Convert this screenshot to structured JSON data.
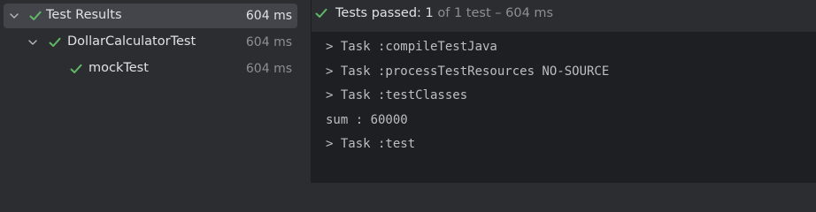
{
  "tree": {
    "items": [
      {
        "label": "Test Results",
        "time": "604 ms",
        "expanded": true,
        "selected": true,
        "status_icon": "check-icon"
      },
      {
        "label": "DollarCalculatorTest",
        "time": "604 ms",
        "expanded": true,
        "selected": false,
        "status_icon": "check-icon"
      },
      {
        "label": "mockTest",
        "time": "604 ms",
        "expanded": false,
        "selected": false,
        "status_icon": "check-icon"
      }
    ]
  },
  "status": {
    "prefix": "Tests passed:",
    "passed": "1",
    "suffix": "of 1 test – 604 ms"
  },
  "console": {
    "lines": [
      "> Task :compileTestJava",
      "> Task :processTestResources NO-SOURCE",
      "> Task :testClasses",
      "sum : 60000",
      "> Task :test"
    ]
  },
  "colors": {
    "success_green": "#5fb865",
    "panel_bg": "#2b2d30",
    "console_bg": "#1e1f22",
    "selection_bg": "#43454a",
    "text": "#dfe1e5",
    "text_dim": "#8c8f94"
  }
}
